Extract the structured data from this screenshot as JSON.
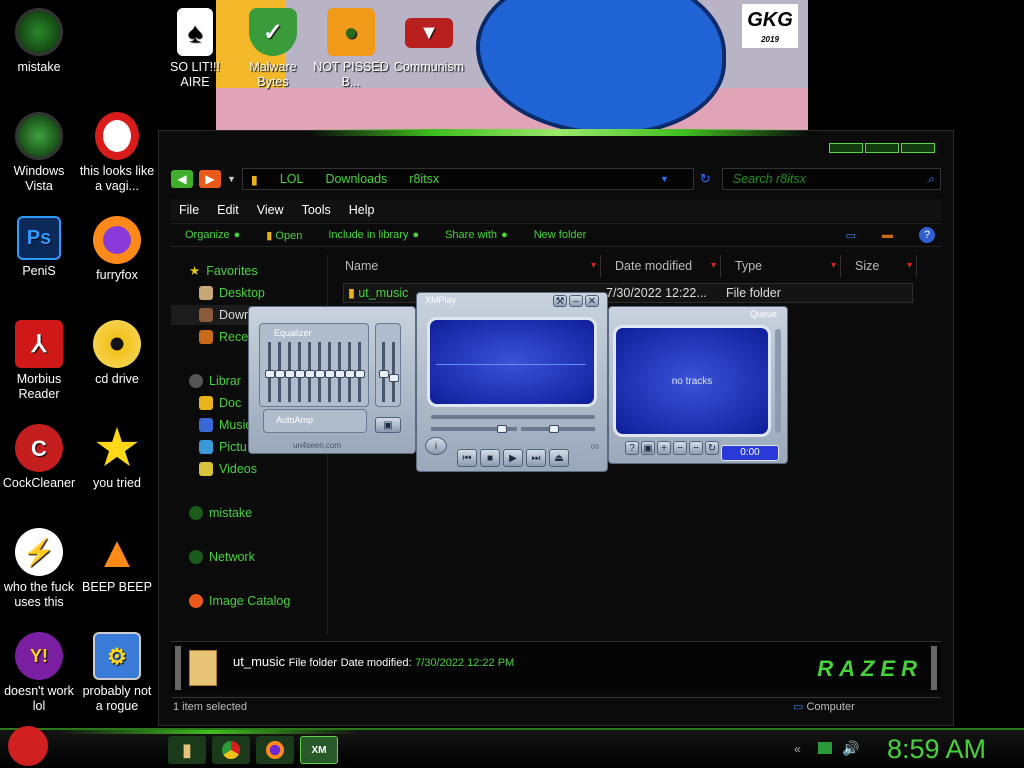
{
  "desktop": {
    "col1": [
      {
        "label": "mistake"
      },
      {
        "label": "Windows Vista"
      },
      {
        "label": "PeniS"
      },
      {
        "label": "Morbius Reader"
      },
      {
        "label": "CockCleaner"
      },
      {
        "label": "who the fuck uses this"
      },
      {
        "label": "doesn't work lol"
      }
    ],
    "col2": [
      {
        "label": "this looks like a vagi..."
      },
      {
        "label": "furryfox"
      },
      {
        "label": "cd drive"
      },
      {
        "label": "you tried"
      },
      {
        "label": "BEEP BEEP"
      },
      {
        "label": "probably not a rogue"
      }
    ],
    "row_top": [
      {
        "label": "SO LIT!!! AIRE"
      },
      {
        "label": "Malware Bytes"
      },
      {
        "label": "NOT PISSED B..."
      },
      {
        "label": "Communism"
      }
    ]
  },
  "wallpaper": {
    "logo_text": "GKG",
    "logo_year": "2019"
  },
  "explorer": {
    "breadcrumb": [
      "LOL",
      "Downloads",
      "r8itsx"
    ],
    "search_placeholder": "Search r8itsx",
    "menu": [
      "File",
      "Edit",
      "View",
      "Tools",
      "Help"
    ],
    "commands": [
      "Organize",
      "Open",
      "Include in library",
      "Share with",
      "New folder"
    ],
    "nav": {
      "favorites": "Favorites",
      "desktop": "Desktop",
      "downloads": "Down",
      "recent": "Rece",
      "libraries": "Librar",
      "documents": "Doc",
      "music": "Music",
      "pictures": "Pictu",
      "videos": "Videos",
      "mistake": "mistake",
      "network": "Network",
      "image_catalog": "Image Catalog"
    },
    "columns": [
      "Name",
      "Date modified",
      "Type",
      "Size"
    ],
    "files": [
      {
        "name": "ut_music",
        "date": "7/30/2022 12:22...",
        "type": "File folder",
        "size": ""
      }
    ],
    "details": {
      "name": "ut_music",
      "kind": "File folder",
      "date_label": "Date modified:",
      "date_value": "7/30/2022 12:22 PM"
    },
    "status_left": "1 item selected",
    "status_right": "Computer",
    "brand": "RAZER"
  },
  "xmplay": {
    "title": "XMPlay",
    "eq_label": "Equalizer",
    "autoamp_label": "AutoAmp",
    "site": "un4seen.com",
    "queue_label": "Queue",
    "queue_empty": "no tracks",
    "time": "0:00"
  },
  "taskbar": {
    "clock": "8:59 AM"
  }
}
